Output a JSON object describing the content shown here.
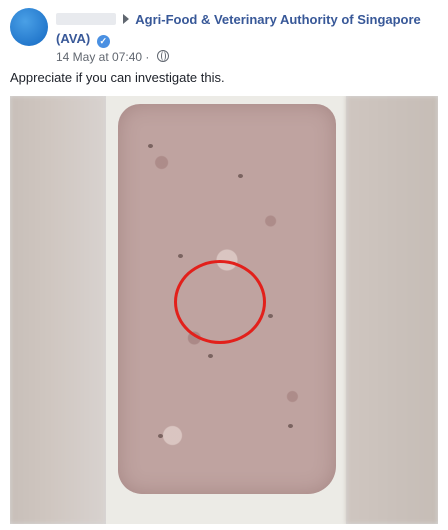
{
  "post": {
    "author_name_redacted": "",
    "page_name": "Agri-Food & Veterinary Authority of Singapore (AVA)",
    "timestamp": "14 May at 07:40",
    "audience": "·",
    "text": "Appreciate if you can investigate this."
  },
  "icons": {
    "avatar": "avatar-circle",
    "arrow": "right-triangle-arrow",
    "verified": "verified-badge",
    "globe": "globe-icon"
  },
  "colors": {
    "link": "#385898",
    "meta": "#616770",
    "text": "#1d2129",
    "verified": "#4a90e2",
    "annotation_circle": "#e2201b"
  }
}
